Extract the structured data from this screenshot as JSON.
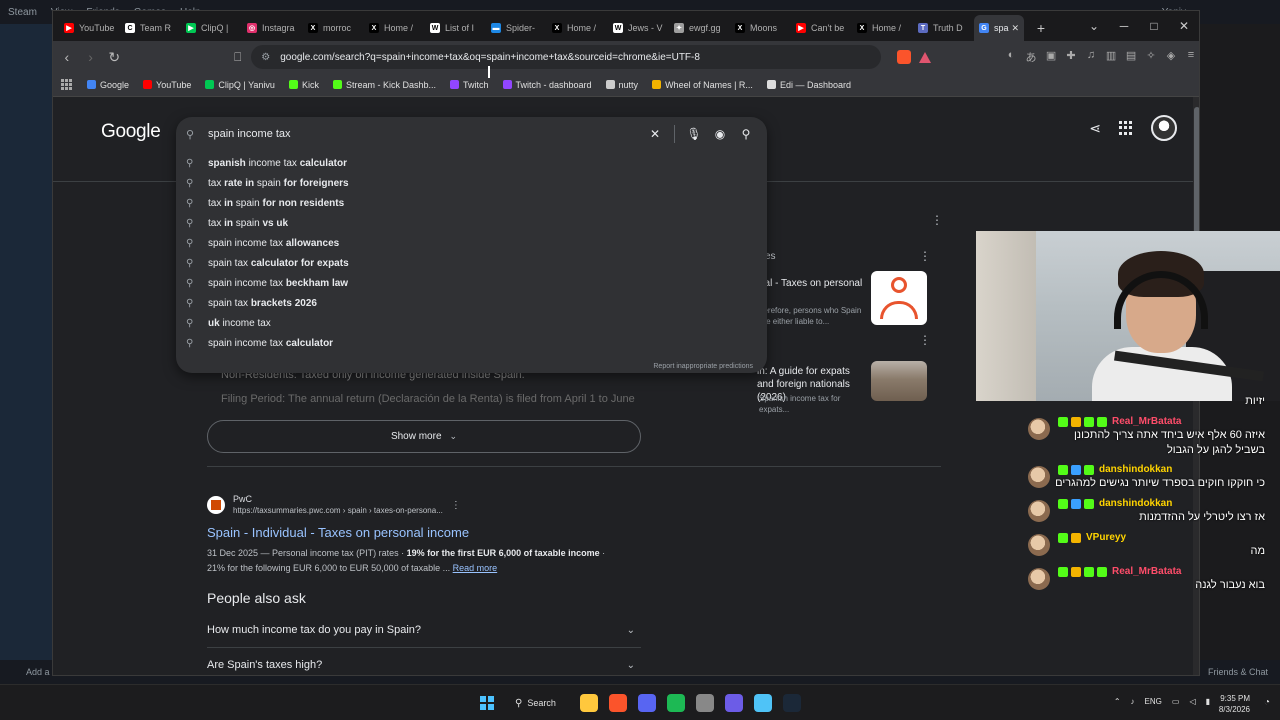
{
  "steam": {
    "menu": [
      "Steam",
      "View",
      "Friends",
      "Games",
      "Help"
    ],
    "add_game": "Add a Game",
    "friends_chat": "Friends & Chat",
    "user": "Yaniv"
  },
  "browser": {
    "tabs": [
      {
        "label": "YouTube",
        "color": "#ff0000",
        "glyph": "▶"
      },
      {
        "label": "Team R",
        "color": "#ffffff",
        "glyph": "C"
      },
      {
        "label": "ClipQ |",
        "color": "#00c853",
        "glyph": "▶"
      },
      {
        "label": "Instagra",
        "color": "#e1306c",
        "glyph": "◎"
      },
      {
        "label": "morroc",
        "color": "#000000",
        "glyph": "X"
      },
      {
        "label": "Home /",
        "color": "#000000",
        "glyph": "X"
      },
      {
        "label": "List of I",
        "color": "#ffffff",
        "glyph": "W"
      },
      {
        "label": "Spider-",
        "color": "#1e88e5",
        "glyph": "▬"
      },
      {
        "label": "Home /",
        "color": "#000000",
        "glyph": "X"
      },
      {
        "label": "Jews - V",
        "color": "#ffffff",
        "glyph": "W"
      },
      {
        "label": "ewgf.gg",
        "color": "#9e9e9e",
        "glyph": "✦"
      },
      {
        "label": "Moons",
        "color": "#000000",
        "glyph": "X"
      },
      {
        "label": "Can't be",
        "color": "#ff0000",
        "glyph": "▶"
      },
      {
        "label": "Home /",
        "color": "#000000",
        "glyph": "X"
      },
      {
        "label": "Truth D",
        "color": "#5c6bc0",
        "glyph": "T"
      },
      {
        "label": "spa",
        "color": "#4285f4",
        "glyph": "G",
        "active": true
      }
    ],
    "url": "google.com/search?q=spain+income+tax&oq=spain+income+tax&sourceid=chrome&ie=UTF-8",
    "bookmarks": [
      {
        "label": "Google",
        "color": "#4285f4"
      },
      {
        "label": "YouTube",
        "color": "#ff0000"
      },
      {
        "label": "ClipQ | Yanivu",
        "color": "#00c853"
      },
      {
        "label": "Kick",
        "color": "#53fc18"
      },
      {
        "label": "Stream - Kick Dashb...",
        "color": "#53fc18"
      },
      {
        "label": "Twitch",
        "color": "#9146ff"
      },
      {
        "label": "Twitch - dashboard",
        "color": "#9146ff"
      },
      {
        "label": "nutty",
        "color": "#cccccc"
      },
      {
        "label": "Wheel of Names | R...",
        "color": "#f4b400"
      },
      {
        "label": "Edi — Dashboard",
        "color": "#dddddd"
      }
    ]
  },
  "google": {
    "logo": "Google",
    "query": "spain income tax",
    "suggestions": [
      [
        {
          "t": "spanish",
          "b": true
        },
        {
          "t": " income tax ",
          "b": false
        },
        {
          "t": "calculator",
          "b": true
        }
      ],
      [
        {
          "t": "tax ",
          "b": false
        },
        {
          "t": "rate in",
          "b": true
        },
        {
          "t": " spain ",
          "b": false
        },
        {
          "t": "for foreigners",
          "b": true
        }
      ],
      [
        {
          "t": "tax ",
          "b": false
        },
        {
          "t": "in",
          "b": true
        },
        {
          "t": " spain ",
          "b": false
        },
        {
          "t": "for non residents",
          "b": true
        }
      ],
      [
        {
          "t": "tax ",
          "b": false
        },
        {
          "t": "in",
          "b": true
        },
        {
          "t": " spain ",
          "b": false
        },
        {
          "t": "vs uk",
          "b": true
        }
      ],
      [
        {
          "t": "spain income tax ",
          "b": false
        },
        {
          "t": "allowances",
          "b": true
        }
      ],
      [
        {
          "t": "spain tax ",
          "b": false
        },
        {
          "t": "calculator for expats",
          "b": true
        }
      ],
      [
        {
          "t": "spain income tax ",
          "b": false
        },
        {
          "t": "beckham law",
          "b": true
        }
      ],
      [
        {
          "t": "spain tax ",
          "b": false
        },
        {
          "t": "brackets 2026",
          "b": true
        }
      ],
      [
        {
          "t": "uk",
          "b": true
        },
        {
          "t": " income tax",
          "b": false
        }
      ],
      [
        {
          "t": "spain income tax ",
          "b": false
        },
        {
          "t": "calculator",
          "b": true
        }
      ]
    ],
    "report": "Report inappropriate predictions",
    "under_text": {
      "nonres": "Non-Residents: Taxed only on income generated inside Spain.",
      "filing": "Filing Period: The annual return (Declaración de la Renta) is filed from April 1 to June"
    },
    "right_panel": {
      "title": "es",
      "item1_title": "ual - Taxes on personal",
      "item1_sub": "herefore, persons who Spain are either liable to...",
      "item2_title": "in: A guide for expats and foreign nationals (2026)",
      "item2_sub": "Spanish income tax for expats..."
    },
    "show_more": "Show more",
    "result": {
      "site": "PwC",
      "url": "https://taxsummaries.pwc.com › spain › taxes-on-persona...",
      "title": "Spain - Individual - Taxes on personal income",
      "date": "31 Dec 2025 — Personal income tax (PIT) rates ·",
      "bold": "19% for the first EUR 6,000 of taxable income",
      "rest": "21% for the following EUR 6,000 to EUR 50,000 of taxable ...",
      "read_more": "Read more"
    },
    "paa": {
      "title": "People also ask",
      "items": [
        "How much income tax do you pay in Spain?",
        "Are Spain's taxes high?"
      ]
    }
  },
  "chat": [
    {
      "name": "",
      "color": "#ffffff",
      "text": "יזיות",
      "badges": []
    },
    {
      "name": "Real_MrBatata",
      "color": "#ff4d6a",
      "text": "איזה 60 אלף איש ביחד אתה צריך להתכונן בשביל להגן על הגבול",
      "badges": [
        "#53fc18",
        "#f4b400",
        "#53fc18",
        "#53fc18"
      ]
    },
    {
      "name": "danshindokkan",
      "color": "#ffd400",
      "text": "כי חוקקו חוקים בספרד שיותר נגישים למהגרים",
      "badges": [
        "#53fc18",
        "#3aa0ff",
        "#53fc18"
      ]
    },
    {
      "name": "danshindokkan",
      "color": "#ffd400",
      "text": "אז רצו ליטרלי על ההזדמנות",
      "badges": [
        "#53fc18",
        "#3aa0ff",
        "#53fc18"
      ]
    },
    {
      "name": "VPureyy",
      "color": "#ffd400",
      "text": "מה",
      "badges": [
        "#53fc18",
        "#f4b400"
      ]
    },
    {
      "name": "Real_MrBatata",
      "color": "#ff4d6a",
      "text": "בוא נעבור לגנה",
      "badges": [
        "#53fc18",
        "#f4b400",
        "#53fc18",
        "#53fc18"
      ]
    }
  ],
  "taskbar": {
    "search": "Search",
    "lang": "ENG",
    "time": "9:35 PM",
    "date": "8/3/2026",
    "apps": [
      "#ffc83d",
      "#fb542b",
      "#5865f2",
      "#1db954",
      "#888888",
      "#6c5ce7",
      "#4fc3f7",
      "#1b2838"
    ]
  }
}
